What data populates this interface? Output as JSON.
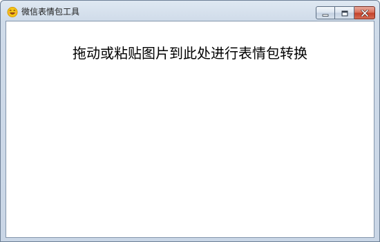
{
  "window": {
    "title": "微信表情包工具",
    "icon": "emoji-face-icon"
  },
  "caption_buttons": {
    "minimize": "minimize-icon",
    "maximize": "maximize-icon",
    "close": "close-icon"
  },
  "main": {
    "drop_hint": "拖动或粘贴图片到此处进行表情包转换"
  },
  "colors": {
    "frame": "#c9d6e6",
    "close_button": "#c2412a",
    "icon_face": "#f5c518"
  }
}
